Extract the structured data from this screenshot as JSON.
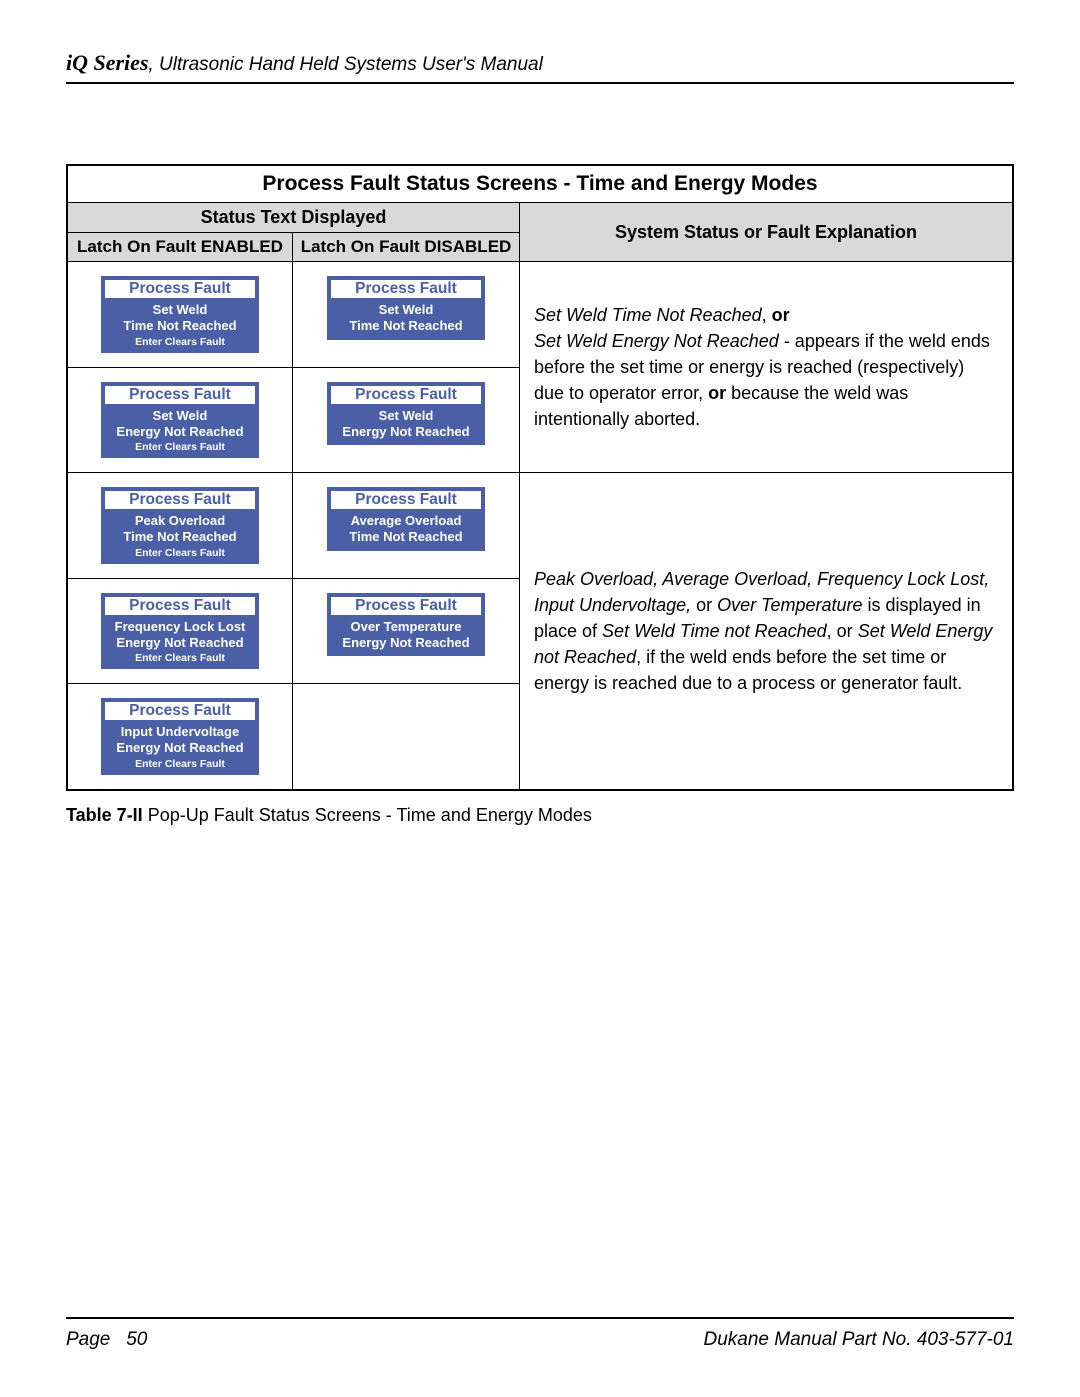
{
  "header": {
    "series": "iQ Series",
    "rest": ", Ultrasonic Hand Held Systems User's Manual"
  },
  "table": {
    "title": "Process Fault Status Screens - Time and Energy Modes",
    "status_header": "Status Text Displayed",
    "explanation_header": "System Status or Fault Explanation",
    "col_enabled": "Latch On Fault ENABLED",
    "col_disabled": "Latch On Fault DISABLED"
  },
  "pf_title": "Process Fault",
  "clear_text": "Enter Clears Fault",
  "popups": {
    "r1a_en": {
      "l1": "Set Weld",
      "l2": "Time Not Reached",
      "clear": true
    },
    "r1a_di": {
      "l1": "Set Weld",
      "l2": "Time Not Reached",
      "clear": false
    },
    "r1b_en": {
      "l1": "Set Weld",
      "l2": "Energy Not Reached",
      "clear": true
    },
    "r1b_di": {
      "l1": "Set Weld",
      "l2": "Energy Not Reached",
      "clear": false
    },
    "r2a_en": {
      "l1": "Peak Overload",
      "l2": "Time Not Reached",
      "clear": true
    },
    "r2a_di": {
      "l1": "Average Overload",
      "l2": "Time Not Reached",
      "clear": false
    },
    "r2b_en": {
      "l1": "Frequency Lock Lost",
      "l2": "Energy Not Reached",
      "clear": true
    },
    "r2b_di": {
      "l1": "Over Temperature",
      "l2": "Energy Not Reached",
      "clear": false
    },
    "r2c_en": {
      "l1": "Input Undervoltage",
      "l2": "Energy Not Reached",
      "clear": true
    }
  },
  "explain1": {
    "i1": "Set Weld Time Not Reached",
    "t1": ", ",
    "b1": "or",
    "br": "",
    "i2": "Set Weld Energy Not Reached",
    "t2": " - appears if the weld ends before the set time or energy is reached (respectively) due to operator error, ",
    "b2": "or",
    "t3": " because the weld was intentionally aborted."
  },
  "explain2": {
    "i1": "Peak Overload, Average Overload, Frequency Lock Lost, Input Undervoltage,",
    "t1": " or ",
    "i2": "Over Temperature",
    "t2": " is displayed in place of ",
    "i3": "Set Weld Time not Reached",
    "t3": ", or ",
    "i4": "Set Weld Energy not Reached",
    "t4": ", if the weld ends before the set time or energy is reached due to a process or generator fault."
  },
  "caption": {
    "label": "Table 7-II",
    "text": " Pop-Up Fault Status Screens - Time and Energy Modes"
  },
  "footer": {
    "left_label": "Page",
    "page_no": "50",
    "right": "Dukane Manual Part No. 403-577-01"
  }
}
